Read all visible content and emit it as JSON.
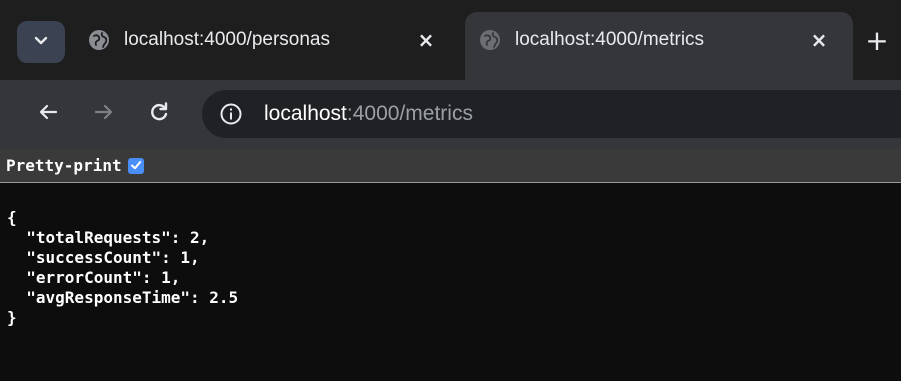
{
  "tabs": [
    {
      "title": "localhost:4000/personas",
      "active": false,
      "close": "×"
    },
    {
      "title": "localhost:4000/metrics",
      "active": true,
      "close": "×"
    }
  ],
  "tab_search_icon": "chevron-down-icon",
  "new_tab": {
    "label": "+",
    "icon": "plus-icon"
  },
  "toolbar": {
    "back_icon": "arrow-left-icon",
    "forward_icon": "arrow-right-icon",
    "reload_icon": "reload-icon",
    "site_info_icon": "info-icon"
  },
  "address": {
    "host": "localhost",
    "rest": ":4000/metrics"
  },
  "pretty_print": {
    "label": "Pretty-print",
    "checked": true
  },
  "json_lines": {
    "open": "{",
    "l1": "  \"totalRequests\": 2,",
    "l2": "  \"successCount\": 1,",
    "l3": "  \"errorCount\": 1,",
    "l4": "  \"avgResponseTime\": 2.5",
    "close": "}"
  },
  "colors": {
    "tabstrip_bg": "#1e1e1e",
    "toolbar_bg": "#35363a",
    "omnibox_bg": "#202124",
    "page_bg": "#0d0d0d",
    "checkbox_accent": "#4a8ff8"
  }
}
